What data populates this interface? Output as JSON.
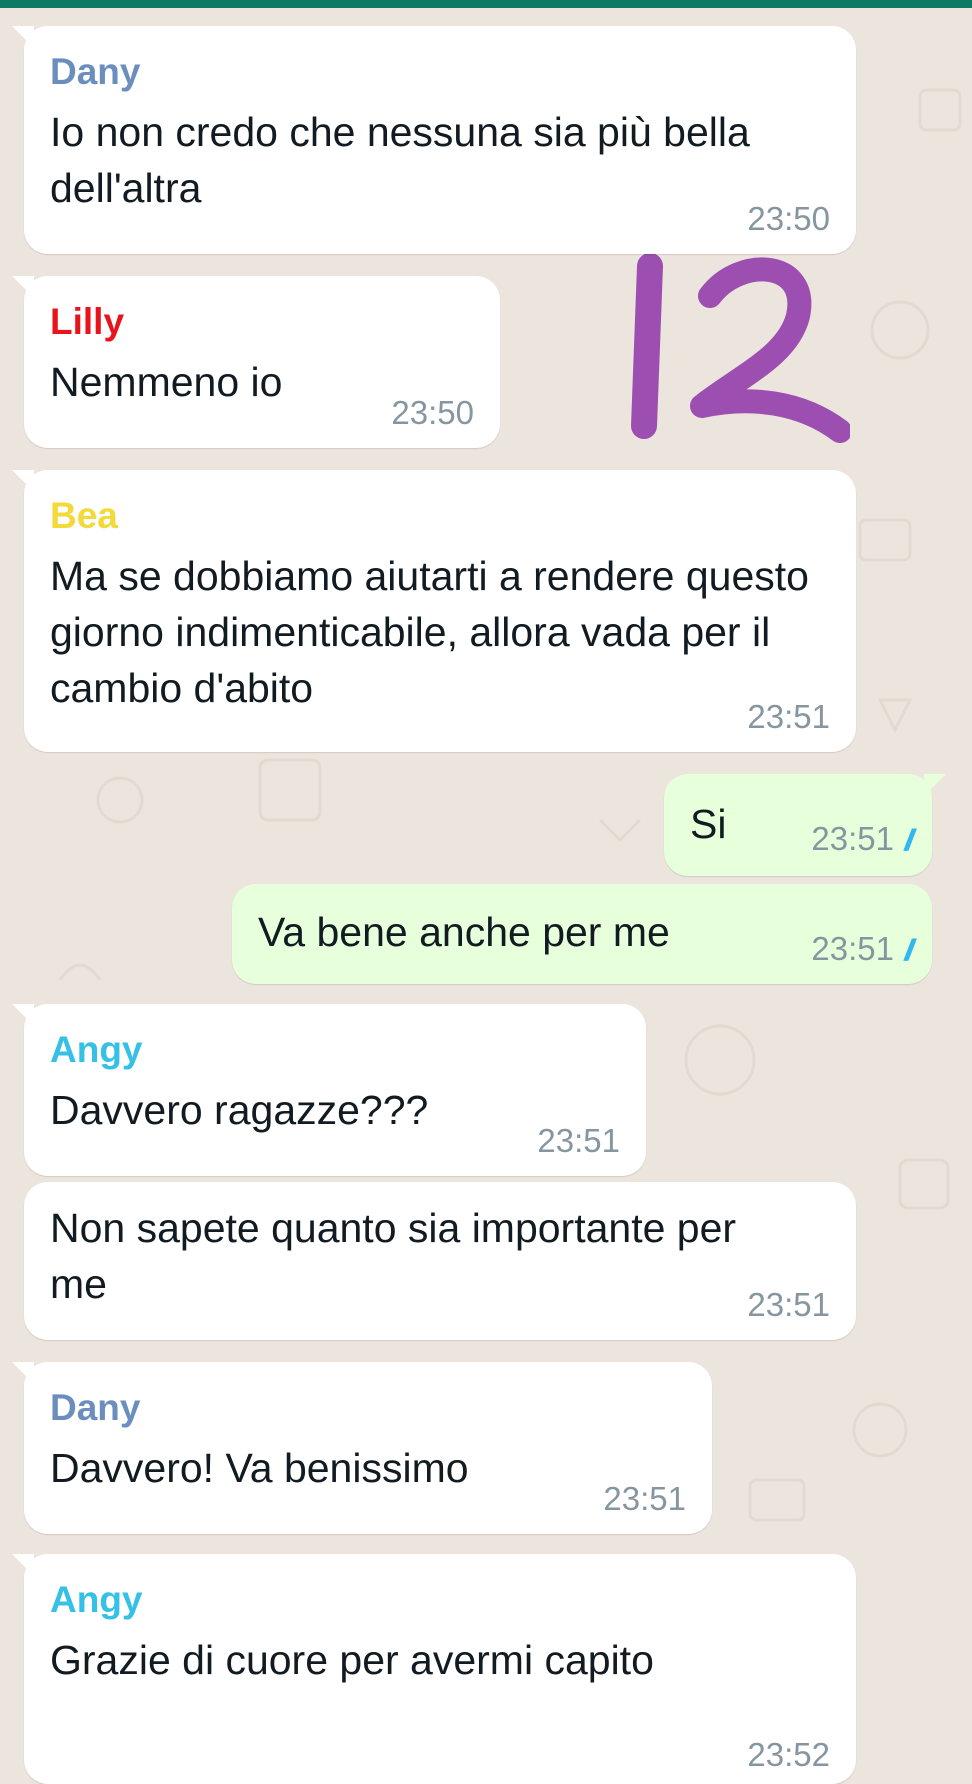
{
  "colors": {
    "topbar": "#0f7a63",
    "wallpaper": "#ece5dd",
    "incoming_bubble": "#ffffff",
    "outgoing_bubble": "#e7ffdb",
    "timestamp": "#8696a0",
    "read_ticks": "#34b7f1",
    "overlay_number": "#9c4fb0"
  },
  "overlay": {
    "text": "12"
  },
  "messages": [
    {
      "sender": "Dany",
      "sender_color": "#6c8ebf",
      "text": "Io non credo che nessuna sia più bella dell'altra",
      "time": "23:50"
    },
    {
      "sender": "Lilly",
      "sender_color": "#e8141b",
      "text": "Nemmeno io",
      "time": "23:50"
    },
    {
      "sender": "Bea",
      "sender_color": "#f3d93a",
      "text": "Ma se dobbiamo aiutarti a rendere questo giorno indimenticabile, allora vada per il cambio d'abito",
      "time": "23:51"
    },
    {
      "text": "Si",
      "time": "23:51",
      "status": "read",
      "ticks_icon": "double-check-icon"
    },
    {
      "text": "Va bene anche per me",
      "time": "23:51",
      "status": "read",
      "ticks_icon": "double-check-icon"
    },
    {
      "sender": "Angy",
      "sender_color": "#35c1e6",
      "text": "Davvero ragazze???",
      "time": "23:51"
    },
    {
      "text": "Non sapete quanto sia importante per me",
      "time": "23:51"
    },
    {
      "sender": "Dany",
      "sender_color": "#6c8ebf",
      "text": "Davvero! Va benissimo",
      "time": "23:51"
    },
    {
      "sender": "Angy",
      "sender_color": "#35c1e6",
      "text": "Grazie di cuore per avermi capito",
      "time": "23:52"
    }
  ]
}
